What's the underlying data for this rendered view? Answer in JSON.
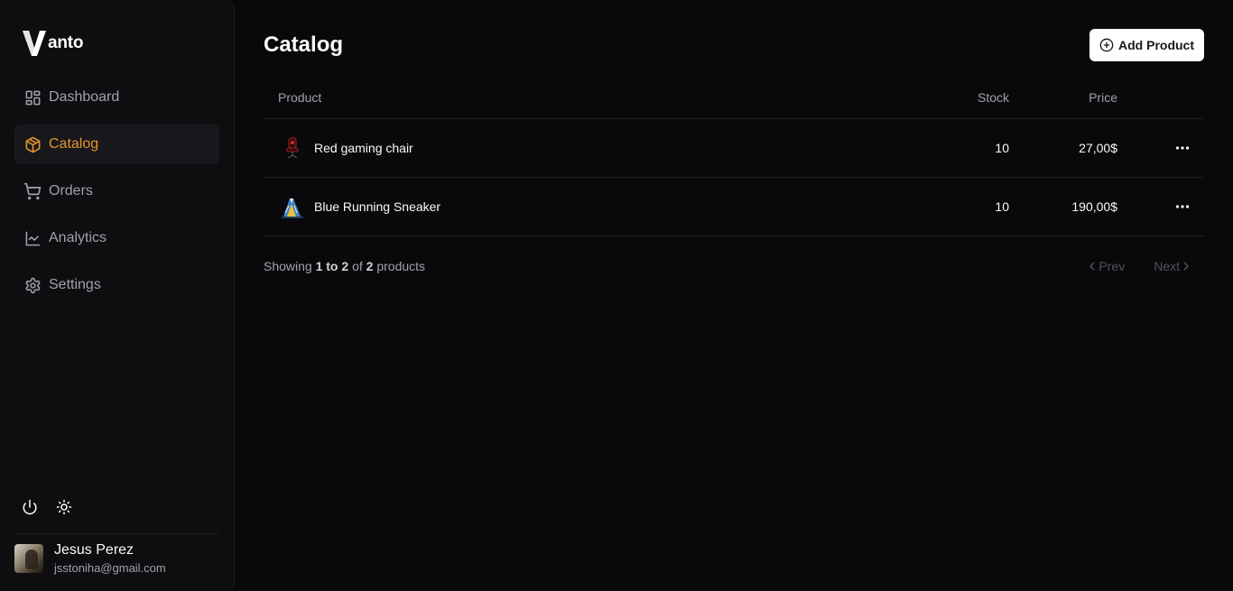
{
  "brand": {
    "name": "anto",
    "logo_letter": "V"
  },
  "sidebar": {
    "items": [
      {
        "label": "Dashboard",
        "icon": "dashboard-grid-icon",
        "active": false
      },
      {
        "label": "Catalog",
        "icon": "package-icon",
        "active": true
      },
      {
        "label": "Orders",
        "icon": "shopping-cart-icon",
        "active": false
      },
      {
        "label": "Analytics",
        "icon": "line-chart-icon",
        "active": false
      },
      {
        "label": "Settings",
        "icon": "gear-icon",
        "active": false
      }
    ],
    "actions": [
      {
        "icon": "power-icon"
      },
      {
        "icon": "sun-icon"
      }
    ],
    "user": {
      "name": "Jesus Perez",
      "email": "jsstoniha@gmail.com"
    }
  },
  "main": {
    "title": "Catalog",
    "add_button_label": "Add Product",
    "table": {
      "headers": {
        "product": "Product",
        "stock": "Stock",
        "price": "Price"
      },
      "rows": [
        {
          "name": "Red gaming chair",
          "stock": "10",
          "price": "27,00$",
          "thumb": "gaming-chair-image"
        },
        {
          "name": "Blue Running Sneaker",
          "stock": "10",
          "price": "190,00$",
          "thumb": "sneaker-image"
        }
      ]
    },
    "pagination": {
      "showing_prefix": "Showing",
      "range": "1 to 2",
      "of_word": "of",
      "total": "2",
      "suffix": "products",
      "prev_label": "Prev",
      "next_label": "Next"
    }
  },
  "colors": {
    "accent": "#e5962b",
    "background": "#09090b",
    "sidebar": "#0e0e11"
  }
}
